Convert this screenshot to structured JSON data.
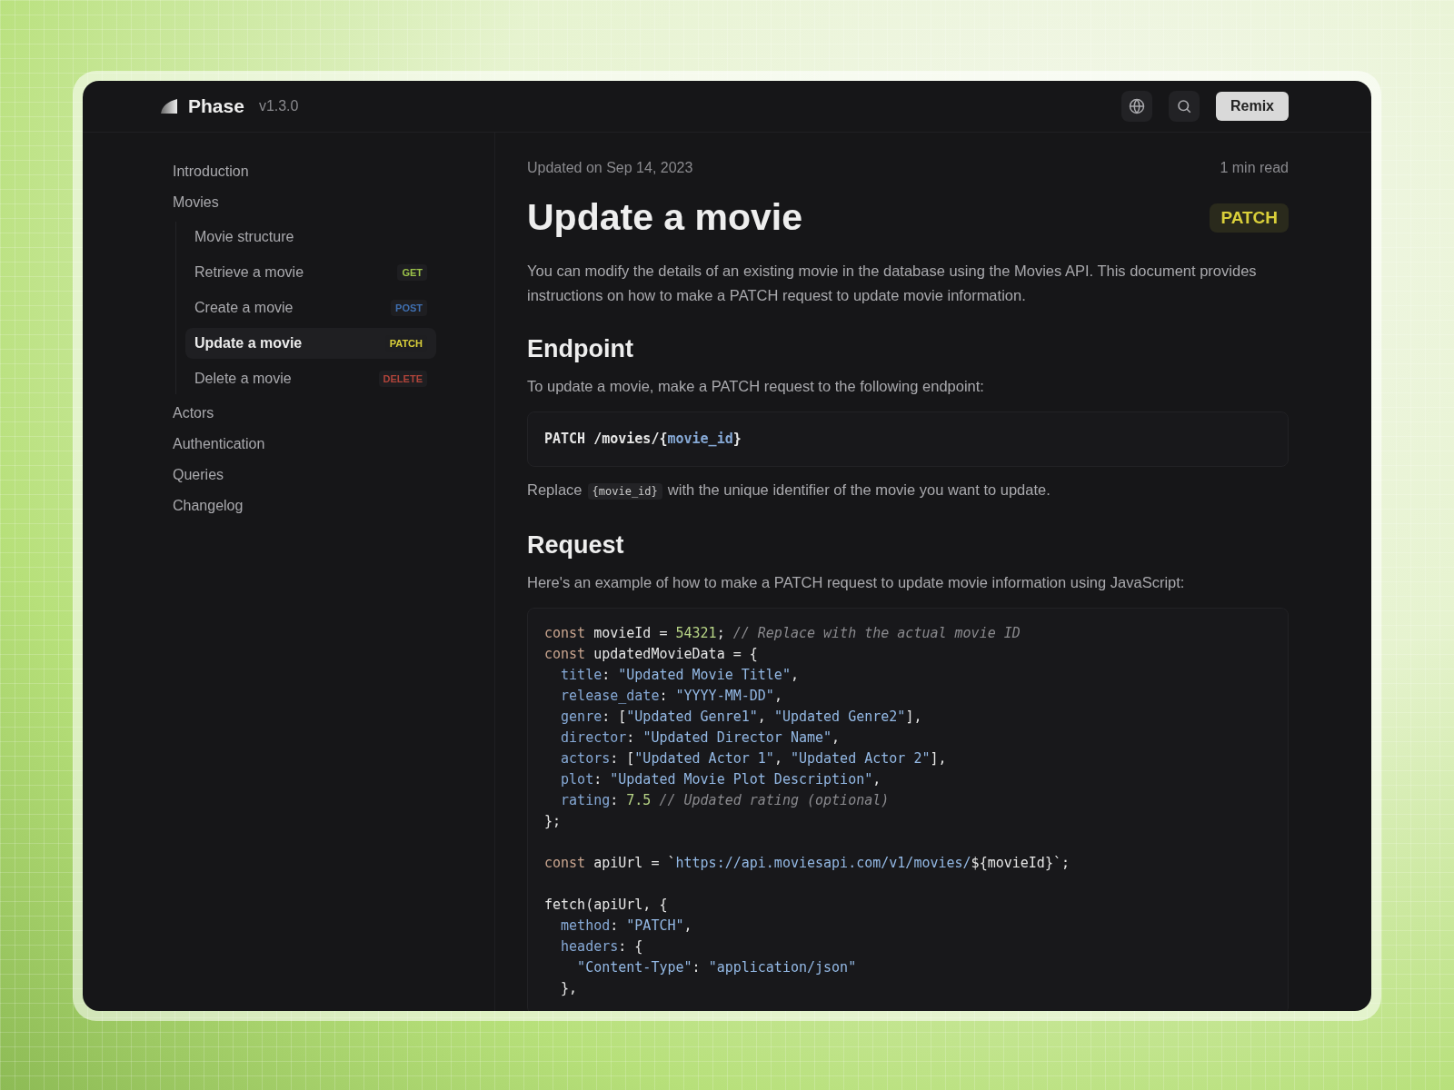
{
  "header": {
    "brand": "Phase",
    "version": "v1.3.0",
    "action": "Remix"
  },
  "sidebar": {
    "items": [
      {
        "label": "Introduction",
        "selected": false
      },
      {
        "label": "Movies",
        "selected": false,
        "children": [
          {
            "label": "Movie structure",
            "selected": false
          },
          {
            "label": "Retrieve a movie",
            "selected": false,
            "badge": {
              "text": "GET",
              "color": "#9bc24a"
            }
          },
          {
            "label": "Create a movie",
            "selected": false,
            "badge": {
              "text": "POST",
              "color": "#3f6fb0"
            }
          },
          {
            "label": "Update a movie",
            "selected": true,
            "badge": {
              "text": "PATCH",
              "color": "#d9cf3a"
            }
          },
          {
            "label": "Delete a movie",
            "selected": false,
            "badge": {
              "text": "DELETE",
              "color": "#b0443a"
            }
          }
        ]
      },
      {
        "label": "Actors",
        "selected": false
      },
      {
        "label": "Authentication",
        "selected": false
      },
      {
        "label": "Queries",
        "selected": false
      },
      {
        "label": "Changelog",
        "selected": false
      }
    ]
  },
  "article": {
    "updated": "Updated on Sep 14, 2023",
    "read_time": "1 min read",
    "title": "Update a movie",
    "method": {
      "text": "PATCH",
      "color": "#d9cf3a"
    },
    "intro": "You can modify the details of an existing movie in the database using the Movies API. This document provides instructions on how to make a PATCH request to update movie information.",
    "sections": [
      {
        "heading": "Endpoint",
        "text": "To update a movie, make a PATCH request to the following endpoint:"
      },
      {
        "heading": "Request",
        "text": "Here's an example of how to make a PATCH request to update movie information using JavaScript:"
      }
    ],
    "endpoint": [
      {
        "kind": "plain",
        "text": "PATCH /movies/{"
      },
      {
        "kind": "prop",
        "text": "movie_id"
      },
      {
        "kind": "plain",
        "text": "}"
      }
    ],
    "replace": {
      "before": "Replace",
      "code": "{movie_id}",
      "after": "with the unique identifier of the movie you want to update."
    },
    "code": [
      {
        "kind": "code",
        "tokens": [
          {
            "kind": "keyword",
            "text": "const"
          },
          {
            "kind": "plain",
            "text": " movieId = "
          },
          {
            "kind": "number",
            "text": "54321"
          },
          {
            "kind": "plain",
            "text": "; "
          },
          {
            "kind": "comment",
            "text": "// Replace with the actual movie ID"
          }
        ]
      },
      {
        "kind": "code",
        "tokens": [
          {
            "kind": "keyword",
            "text": "const"
          },
          {
            "kind": "plain",
            "text": " updatedMovieData = {"
          }
        ]
      },
      {
        "kind": "code",
        "tokens": [
          {
            "kind": "prop",
            "text": "  title"
          },
          {
            "kind": "plain",
            "text": ": "
          },
          {
            "kind": "string",
            "text": "\"Updated Movie Title\""
          },
          {
            "kind": "plain",
            "text": ","
          }
        ]
      },
      {
        "kind": "code",
        "tokens": [
          {
            "kind": "prop",
            "text": "  release_date"
          },
          {
            "kind": "plain",
            "text": ": "
          },
          {
            "kind": "string",
            "text": "\"YYYY-MM-DD\""
          },
          {
            "kind": "plain",
            "text": ","
          }
        ]
      },
      {
        "kind": "code",
        "tokens": [
          {
            "kind": "prop",
            "text": "  genre"
          },
          {
            "kind": "plain",
            "text": ": ["
          },
          {
            "kind": "string",
            "text": "\"Updated Genre1\""
          },
          {
            "kind": "plain",
            "text": ", "
          },
          {
            "kind": "string",
            "text": "\"Updated Genre2\""
          },
          {
            "kind": "plain",
            "text": "],"
          }
        ]
      },
      {
        "kind": "code",
        "tokens": [
          {
            "kind": "prop",
            "text": "  director"
          },
          {
            "kind": "plain",
            "text": ": "
          },
          {
            "kind": "string",
            "text": "\"Updated Director Name\""
          },
          {
            "kind": "plain",
            "text": ","
          }
        ]
      },
      {
        "kind": "code",
        "tokens": [
          {
            "kind": "prop",
            "text": "  actors"
          },
          {
            "kind": "plain",
            "text": ": ["
          },
          {
            "kind": "string",
            "text": "\"Updated Actor 1\""
          },
          {
            "kind": "plain",
            "text": ", "
          },
          {
            "kind": "string",
            "text": "\"Updated Actor 2\""
          },
          {
            "kind": "plain",
            "text": "],"
          }
        ]
      },
      {
        "kind": "code",
        "tokens": [
          {
            "kind": "prop",
            "text": "  plot"
          },
          {
            "kind": "plain",
            "text": ": "
          },
          {
            "kind": "string",
            "text": "\"Updated Movie Plot Description\""
          },
          {
            "kind": "plain",
            "text": ","
          }
        ]
      },
      {
        "kind": "code",
        "tokens": [
          {
            "kind": "prop",
            "text": "  rating"
          },
          {
            "kind": "plain",
            "text": ": "
          },
          {
            "kind": "number",
            "text": "7.5"
          },
          {
            "kind": "comment",
            "text": " // Updated rating (optional)"
          }
        ]
      },
      {
        "kind": "code",
        "tokens": [
          {
            "kind": "plain",
            "text": "};"
          }
        ]
      },
      {
        "kind": "blank"
      },
      {
        "kind": "code",
        "tokens": [
          {
            "kind": "keyword",
            "text": "const"
          },
          {
            "kind": "plain",
            "text": " apiUrl = `"
          },
          {
            "kind": "string",
            "text": "https://api.moviesapi.com/v1/movies/"
          },
          {
            "kind": "plain",
            "text": "${movieId}`;"
          }
        ]
      },
      {
        "kind": "blank"
      },
      {
        "kind": "code",
        "tokens": [
          {
            "kind": "plain",
            "text": "fetch(apiUrl, {"
          }
        ]
      },
      {
        "kind": "code",
        "tokens": [
          {
            "kind": "prop",
            "text": "  method"
          },
          {
            "kind": "plain",
            "text": ": "
          },
          {
            "kind": "string",
            "text": "\"PATCH\""
          },
          {
            "kind": "plain",
            "text": ","
          }
        ]
      },
      {
        "kind": "code",
        "tokens": [
          {
            "kind": "prop",
            "text": "  headers"
          },
          {
            "kind": "plain",
            "text": ": {"
          }
        ]
      },
      {
        "kind": "code",
        "tokens": [
          {
            "kind": "string",
            "text": "    \"Content-Type\""
          },
          {
            "kind": "plain",
            "text": ": "
          },
          {
            "kind": "string",
            "text": "\"application/json\""
          }
        ]
      },
      {
        "kind": "code",
        "tokens": [
          {
            "kind": "plain",
            "text": "  },"
          }
        ]
      }
    ]
  }
}
